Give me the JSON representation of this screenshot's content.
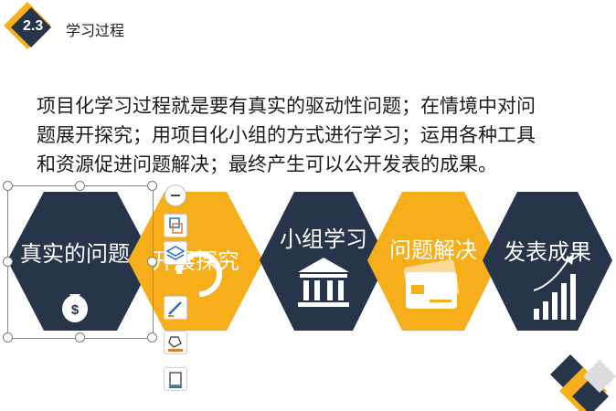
{
  "header": {
    "section_number": "2.3",
    "section_title": "学习过程"
  },
  "description": {
    "lines": [
      "项目化学习过程就是要有真实的驱动性问题；在情境中对问",
      "题展开探究；用项目化小组的方式进行学习；运用各种工具",
      "和资源促进问题解决；最终产生可以公开发表的成果。"
    ]
  },
  "steps": [
    {
      "label": "真实的问题",
      "icon": "dollar-bag-icon",
      "color": "#263549"
    },
    {
      "label": "开展探究",
      "icon": "",
      "color": "#f6ae1b"
    },
    {
      "label": "小组学习",
      "icon": "bank-icon",
      "color": "#263549"
    },
    {
      "label": "问题解决",
      "icon": "credit-card-icon",
      "color": "#f6ae1b"
    },
    {
      "label": "发表成果",
      "icon": "growth-chart-icon",
      "color": "#263549"
    }
  ],
  "toolbar": {
    "buttons": [
      "collapse-icon",
      "arrange-icon",
      "layers-icon",
      "pen-icon",
      "fill-icon",
      "frame-icon"
    ]
  },
  "colors": {
    "navy": "#263549",
    "gold": "#f6ae1b"
  }
}
